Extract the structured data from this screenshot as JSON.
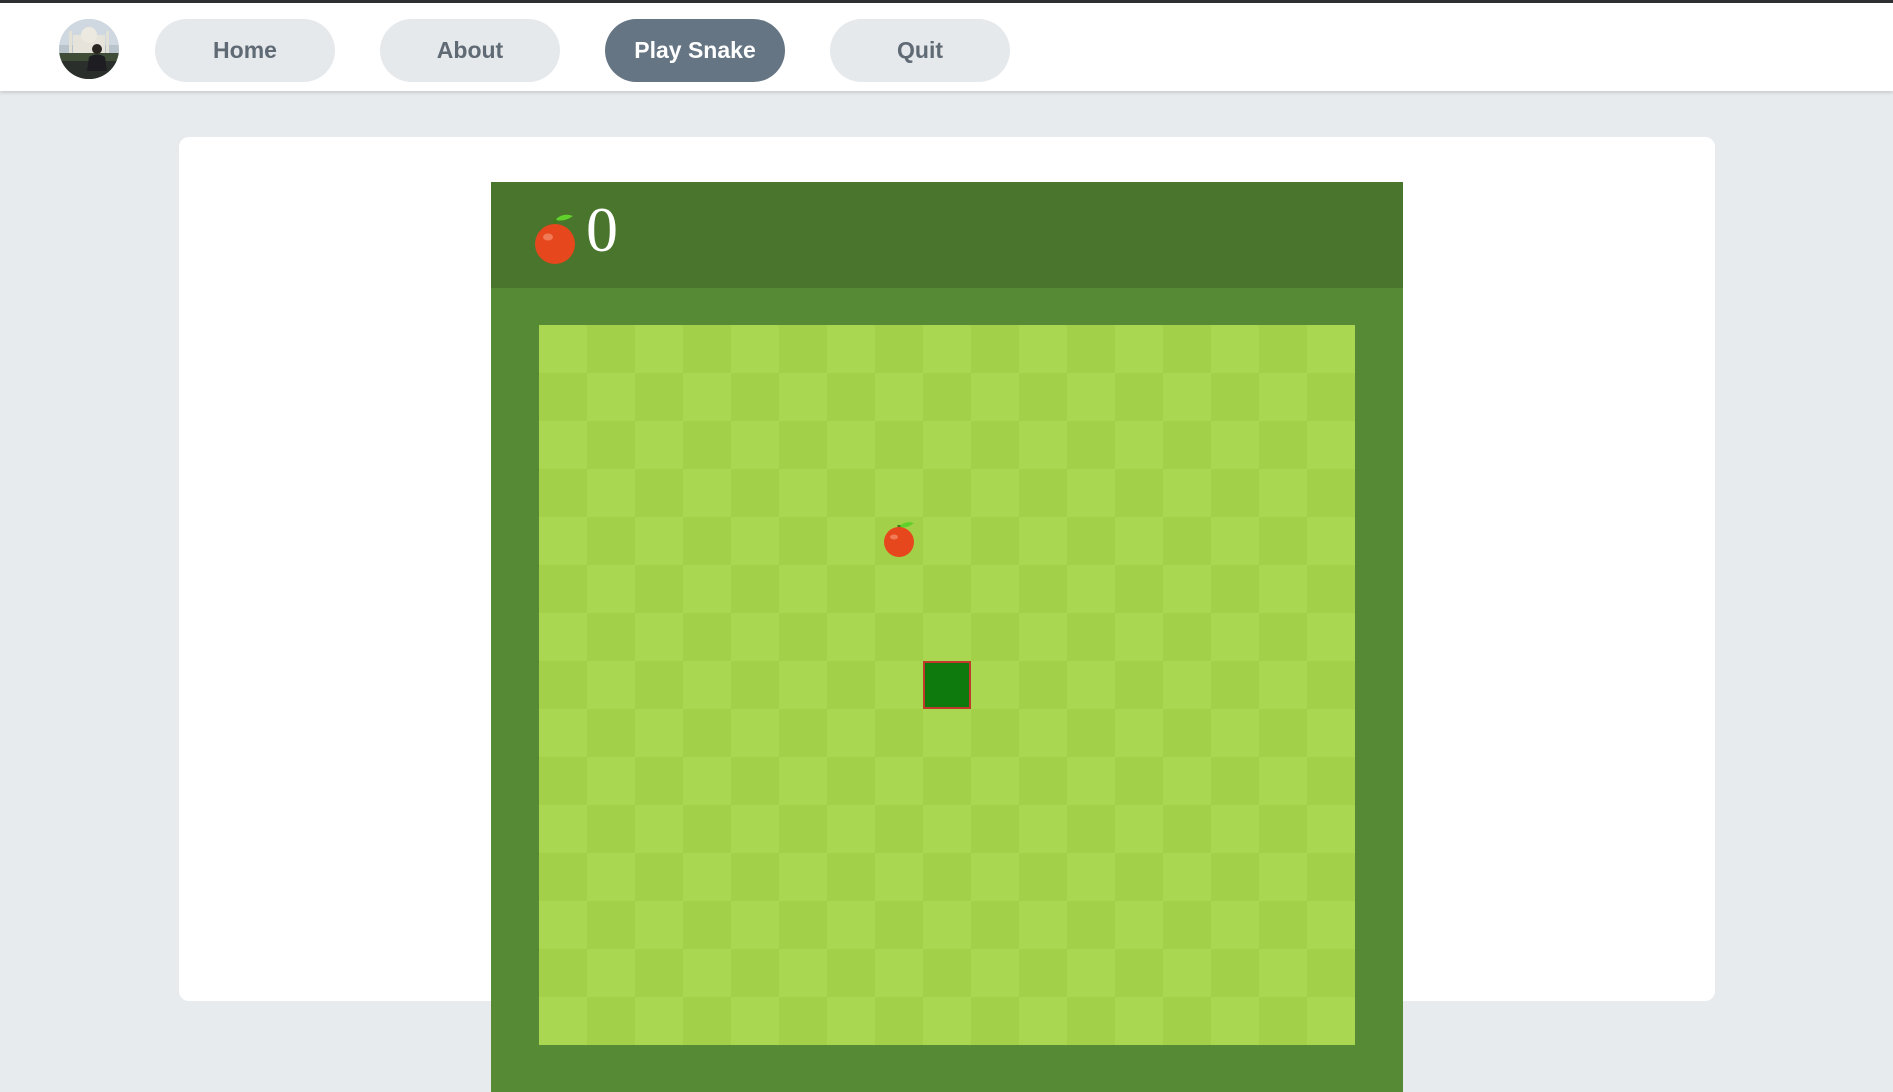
{
  "nav": {
    "items": [
      {
        "label": "Home",
        "active": false
      },
      {
        "label": "About",
        "active": false
      },
      {
        "label": "Play Snake",
        "active": true
      },
      {
        "label": "Quit",
        "active": false
      }
    ]
  },
  "game": {
    "score": "0",
    "grid": {
      "cols": 17,
      "rows": 15
    },
    "apple": {
      "col": 7,
      "row": 4
    },
    "snake": [
      {
        "col": 8,
        "row": 7
      }
    ],
    "colors": {
      "header": "#4a752c",
      "frame": "#578a34",
      "tile_light": "#aad751",
      "tile_dark": "#a2d149",
      "snake": "#0e7a0e",
      "snake_border": "#c0392b",
      "apple": "#e7471d",
      "apple_leaf": "#5fd12a"
    }
  },
  "icons": {
    "score_icon": "apple-icon",
    "food_icon": "apple-icon"
  }
}
